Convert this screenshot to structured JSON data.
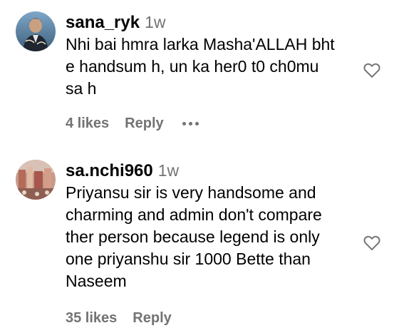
{
  "comments": [
    {
      "username": "sana_ryk",
      "time": "1w",
      "text_lines": [
        "Nhi bai hmra larka Masha'ALLAH bht",
        "e handsum h, un ka her0 t0 ch0mu",
        "sa h"
      ],
      "likes": "4 likes",
      "reply": "Reply",
      "avatar_icon": "avatar-portrait",
      "like_icon": "heart-outline-icon",
      "more_icon": "more-options-icon"
    },
    {
      "username": "sa.nchi960",
      "time": "1w",
      "text_lines": [
        "Priyansu sir is very handsome and",
        "charming and admin don't compare",
        "ther person because legend is only",
        "one priyanshu sir 1000 Bette than",
        "Naseem"
      ],
      "likes": "35 likes",
      "reply": "Reply",
      "avatar_icon": "avatar-photo",
      "like_icon": "heart-outline-icon"
    }
  ],
  "colors": {
    "text": "#000000",
    "secondary": "#737373",
    "background": "#ffffff"
  }
}
